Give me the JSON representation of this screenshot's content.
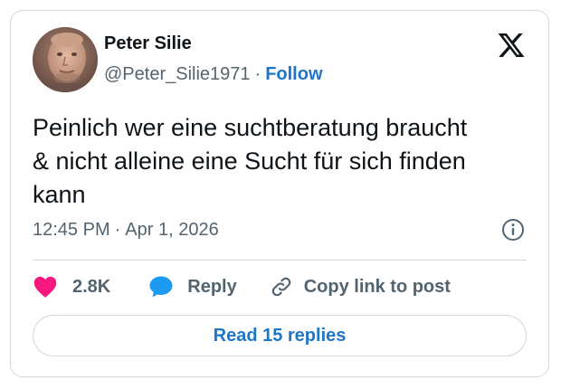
{
  "author": {
    "name": "Peter Silie",
    "handle": "@Peter_Silie1971",
    "separator": "·",
    "follow_label": "Follow"
  },
  "brand": {
    "logo_icon": "x-logo-icon"
  },
  "tweet": {
    "text": "Peinlich wer eine suchtberatung braucht\n& nicht alleine eine Sucht für sich finden\nkann",
    "time": "12:45 PM",
    "date": "Apr 1, 2026",
    "meta_separator": "·"
  },
  "actions": {
    "like_count": "2.8K",
    "reply_label": "Reply",
    "copy_link_label": "Copy link to post"
  },
  "read_replies_label": "Read 15 replies",
  "colors": {
    "like": "#f91880",
    "reply": "#1d9bf0",
    "link": "#1d76c7",
    "secondary_text": "#536471",
    "border": "#cfd9de"
  }
}
